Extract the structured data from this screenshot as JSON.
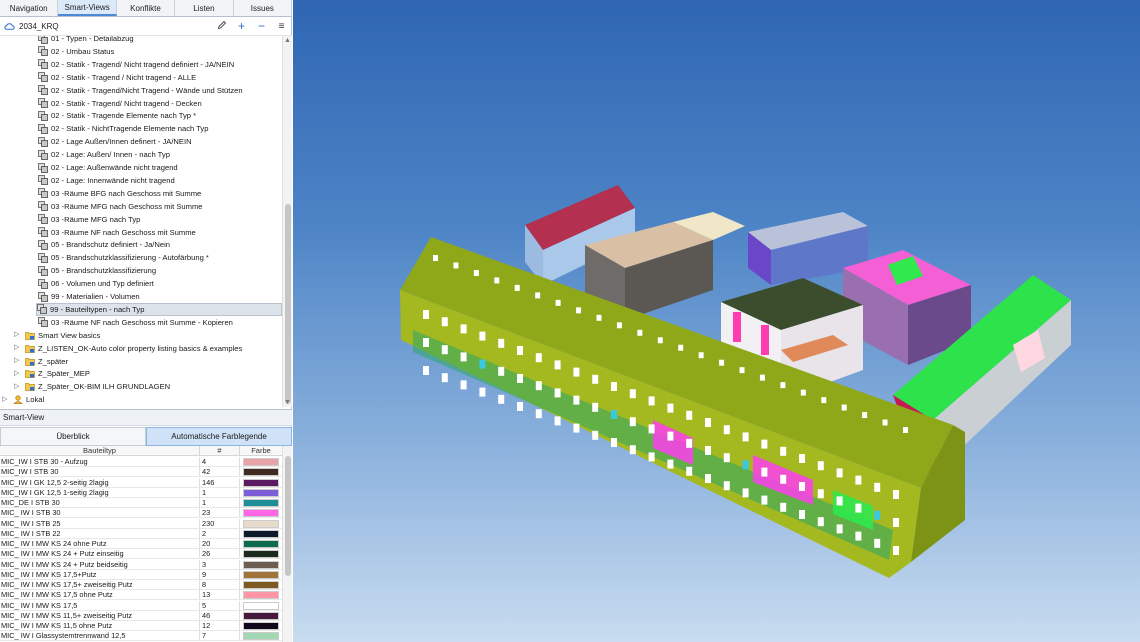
{
  "tabs": [
    "Navigation",
    "Smart-Views",
    "Konflikte",
    "Listen",
    "Issues"
  ],
  "active_tab": "Smart-Views",
  "project": {
    "name": "2034_KRQ"
  },
  "toolbar_icons": [
    "pencil-icon",
    "plus-icon",
    "minus-icon",
    "menu-icon"
  ],
  "tree": {
    "items": [
      {
        "label": "01 - Typen - Detailabzug",
        "type": "view"
      },
      {
        "label": "02 - Umbau Status",
        "type": "view"
      },
      {
        "label": "02 - Statik - Tragend/ Nicht tragend definiert - JA/NEIN",
        "type": "view"
      },
      {
        "label": "02 - Statik - Tragend / Nicht tragend - ALLE",
        "type": "view"
      },
      {
        "label": "02 - Statik - Tragend/Nicht Tragend - Wände und Stützen",
        "type": "view"
      },
      {
        "label": "02 - Statik - Tragend/ Nicht tragend - Decken",
        "type": "view"
      },
      {
        "label": "02 - Statik - Tragende Elemente nach Typ *",
        "type": "view"
      },
      {
        "label": "02 - Statik - NichtTragende Elemente nach Typ",
        "type": "view"
      },
      {
        "label": "02 - Lage Außen/Innen definert - JA/NEIN",
        "type": "view"
      },
      {
        "label": "02 - Lage: Außen/ Innen - nach Typ",
        "type": "view"
      },
      {
        "label": "02 - Lage: Außenwände nicht tragend",
        "type": "view"
      },
      {
        "label": "02 - Lage: Innenwände nicht tragend",
        "type": "view"
      },
      {
        "label": "03 -Räume BFG nach Geschoss mit Summe",
        "type": "view"
      },
      {
        "label": "03 -Räume MFG nach Geschoss mit Summe",
        "type": "view"
      },
      {
        "label": "03 -Räume MFG nach Typ",
        "type": "view"
      },
      {
        "label": "03 -Räume NF nach Geschoss mit Summe",
        "type": "view"
      },
      {
        "label": "05 - Brandschutz definiert -  Ja/Nein",
        "type": "view"
      },
      {
        "label": "05 - Brandschutzklassifizierung - Autofärbung *",
        "type": "view"
      },
      {
        "label": "05 - Brandschutzklassifizierung",
        "type": "view"
      },
      {
        "label": "06 - Volumen und Typ definiert",
        "type": "view"
      },
      {
        "label": "99 - Materialien - Volumen",
        "type": "view"
      },
      {
        "label": "99 - Bauteiltypen - nach Typ",
        "type": "view",
        "selected": true
      },
      {
        "label": "03 -Räume NF nach Geschoss mit Summe  - Kopieren",
        "type": "view"
      },
      {
        "label": "Smart View basics",
        "type": "folder"
      },
      {
        "label": "Z_LISTEN_OK-Auto color property listing basics & examples",
        "type": "folder"
      },
      {
        "label": "Z_später",
        "type": "folder"
      },
      {
        "label": "Z_Später_MEP",
        "type": "folder"
      },
      {
        "label": "Z_Später_OK-BIM ILH GRUNDLAGEN",
        "type": "folder"
      },
      {
        "label": "Lokal",
        "type": "user"
      }
    ]
  },
  "smart_view": {
    "title": "Smart-View",
    "tabs": [
      "Überblick",
      "Automatische Farblegende"
    ],
    "active_tab": "Automatische Farblegende",
    "columns": [
      "Bauteiltyp",
      "#",
      "Farbe"
    ],
    "rows": [
      {
        "type": "MIC_IW I STB 30 - Aufzug",
        "count": "4",
        "color": "#e8a3a9"
      },
      {
        "type": "MIC_IW I STB 30",
        "count": "42",
        "color": "#3f2a22"
      },
      {
        "type": "MIC_IW I GK 12,5 2-seitig 2lagig",
        "count": "146",
        "color": "#5a1b63"
      },
      {
        "type": "MIC_IW I GK 12,5 1-seitig 2lagig",
        "count": "1",
        "color": "#7b5ed8"
      },
      {
        "type": "MIC_DE I STB 30",
        "count": "1",
        "color": "#1e8e97"
      },
      {
        "type": "MIC_ IW I STB 30",
        "count": "23",
        "color": "#ff66e6"
      },
      {
        "type": "MIC_ IW I STB 25",
        "count": "230",
        "color": "#e7dccb"
      },
      {
        "type": "MIC_ IW I STB 22",
        "count": "2",
        "color": "#0c1a2c"
      },
      {
        "type": "MIC_ IW I MW KS 24 ohne Putz",
        "count": "20",
        "color": "#0e6b4d"
      },
      {
        "type": "MIC_ IW I MW KS 24 + Putz einseitig",
        "count": "26",
        "color": "#1a2b1d"
      },
      {
        "type": "MIC_ IW I MW KS 24 + Putz beidseitig",
        "count": "3",
        "color": "#6b5d52"
      },
      {
        "type": "MIC_ IW I MW KS 17,5+Putz",
        "count": "9",
        "color": "#a0733b"
      },
      {
        "type": "MIC_ IW I MW KS 17,5+ zweiseitig Putz",
        "count": "8",
        "color": "#7d5a22"
      },
      {
        "type": "MIC_ IW I MW KS 17,5 ohne Putz",
        "count": "13",
        "color": "#ff96a6"
      },
      {
        "type": "MIC_ IW I MW KS 17,5",
        "count": "5",
        "color": "#ffffff"
      },
      {
        "type": "MIC_ IW I MW KS 11,5+ zweiseitig Putz",
        "count": "46",
        "color": "#461a3d"
      },
      {
        "type": "MIC_ IW I MW KS 11,5 ohne Putz",
        "count": "12",
        "color": "#12081b"
      },
      {
        "type": "MIC_ IW I Glassystemtrennwand 12,5",
        "count": "7",
        "color": "#9fd8b3"
      }
    ]
  },
  "viewport": {
    "model_colors": {
      "main_roof": "#8ea81a",
      "main_wall": "#a4b920",
      "accent_magenta": "#ff3df0",
      "accent_green": "#2fe94d",
      "pink_building": "#f55fd5",
      "crimson": "#c41a4f",
      "light_blue": "#a7c5e8",
      "beige": "#e7cfb0"
    }
  }
}
